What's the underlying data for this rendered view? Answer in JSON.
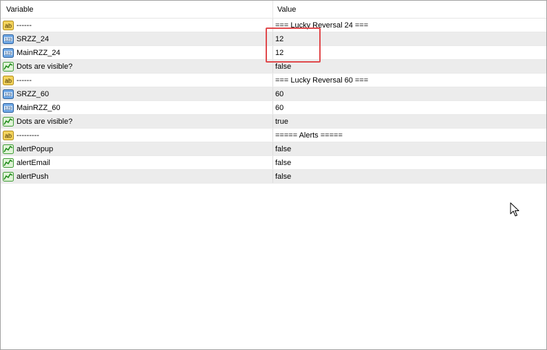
{
  "table": {
    "headers": {
      "variable": "Variable",
      "value": "Value"
    },
    "rows": [
      {
        "type": "string",
        "icon": "string-ab-icon",
        "variable": "------",
        "value": "=== Lucky Reversal 24 ===",
        "centered": true
      },
      {
        "type": "int",
        "icon": "integer-123-icon",
        "variable": "SRZZ_24",
        "value": "12"
      },
      {
        "type": "int",
        "icon": "integer-123-icon",
        "variable": "MainRZZ_24",
        "value": "12"
      },
      {
        "type": "bool",
        "icon": "boolean-chart-icon",
        "variable": "Dots are visible?",
        "value": "false"
      },
      {
        "type": "string",
        "icon": "string-ab-icon",
        "variable": "------",
        "value": "=== Lucky Reversal 60 ===",
        "centered": true
      },
      {
        "type": "int",
        "icon": "integer-123-icon",
        "variable": "SRZZ_60",
        "value": "60"
      },
      {
        "type": "int",
        "icon": "integer-123-icon",
        "variable": "MainRZZ_60",
        "value": "60"
      },
      {
        "type": "bool",
        "icon": "boolean-chart-icon",
        "variable": "Dots are visible?",
        "value": "true"
      },
      {
        "type": "string",
        "icon": "string-ab-icon",
        "variable": "---------",
        "value": "===== Alerts =====",
        "centered": true
      },
      {
        "type": "bool",
        "icon": "boolean-chart-icon",
        "variable": "alertPopup",
        "value": "false"
      },
      {
        "type": "bool",
        "icon": "boolean-chart-icon",
        "variable": "alertEmail",
        "value": "false"
      },
      {
        "type": "bool",
        "icon": "boolean-chart-icon",
        "variable": "alertPush",
        "value": "false"
      }
    ]
  },
  "colors": {
    "highlight": "#e0484b",
    "row_alt": "#ececec"
  }
}
